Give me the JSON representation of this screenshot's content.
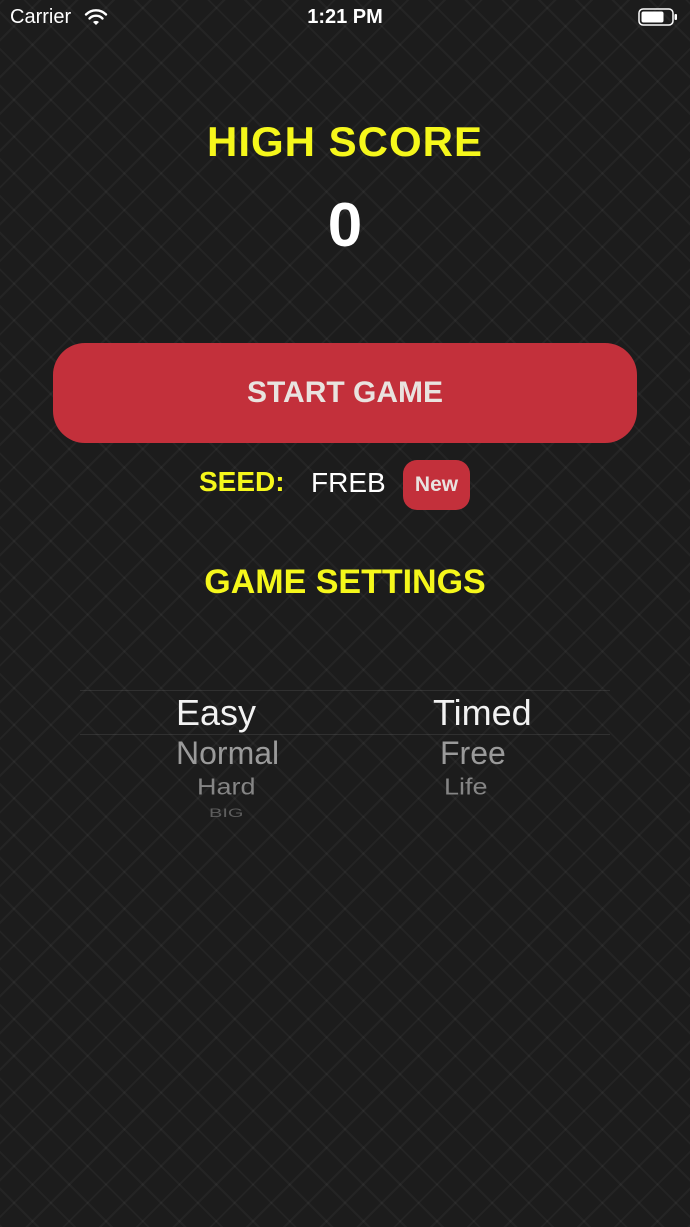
{
  "status_bar": {
    "carrier": "Carrier",
    "time": "1:21 PM",
    "wifi_icon": "wifi-icon",
    "battery_icon": "battery-icon"
  },
  "high_score": {
    "title": "HIGH SCORE",
    "value": "0"
  },
  "start_button": {
    "label": "START GAME"
  },
  "seed": {
    "label": "SEED:",
    "value": "FREB",
    "new_button_label": "New"
  },
  "settings": {
    "title": "GAME SETTINGS",
    "difficulty_options": [
      "Easy",
      "Normal",
      "Hard",
      "BIG"
    ],
    "difficulty_selected": "Easy",
    "mode_options": [
      "Timed",
      "Free",
      "Life"
    ],
    "mode_selected": "Timed"
  },
  "colors": {
    "background": "#1c1c1c",
    "accent_yellow": "#f5f71b",
    "button_red": "#c3303b",
    "button_text": "#e9e3df"
  }
}
